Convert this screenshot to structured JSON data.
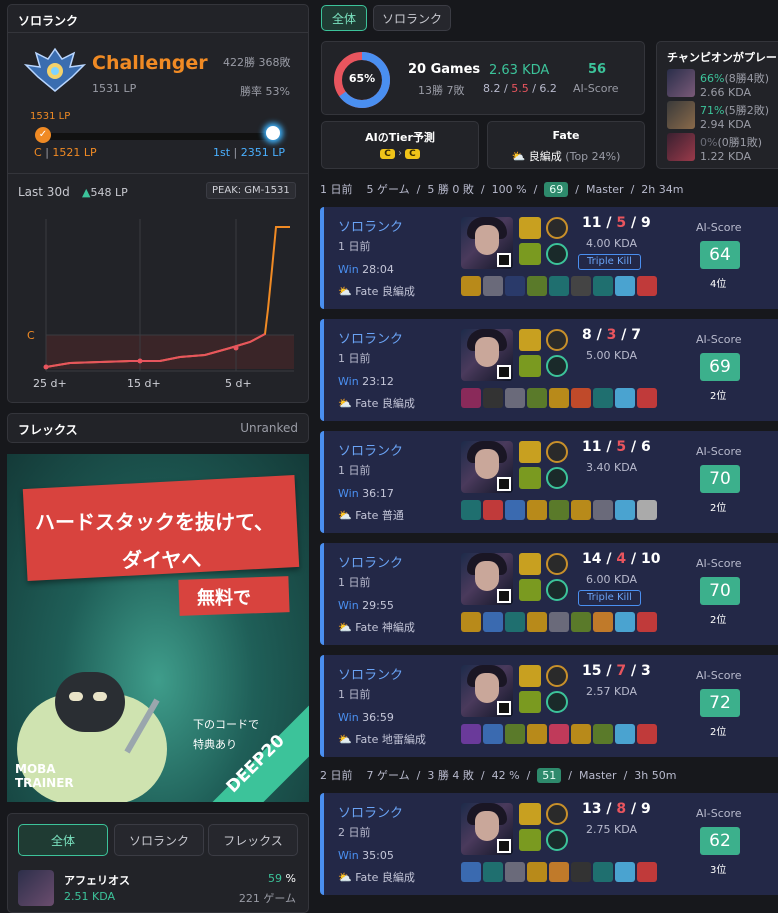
{
  "sidebar": {
    "solo": {
      "title": "ソロランク",
      "tier": "Challenger",
      "lp": "1531 LP",
      "record": "422勝 368敗",
      "winrate": "勝率 53%",
      "current_marker": "1531 LP",
      "current_tier": "C",
      "threshold_label": "1521 LP",
      "first_label": "1st",
      "first_lp": "2351 LP",
      "last30_label": "Last 30d",
      "last30_gain": "548 LP",
      "peak": "PEAK: GM-1531",
      "chart_tier_label": "C",
      "x_ticks": [
        "25 d+",
        "15 d+",
        "5 d+"
      ]
    },
    "flex": {
      "title": "フレックス",
      "status": "Unranked"
    },
    "ad": {
      "line1": "ハードスタックを抜けて、",
      "line2": "ダイヤへ",
      "line3": "無料で",
      "code_line1": "下のコードで",
      "code_line2": "特典あり",
      "brand1": "MOBA",
      "brand2": "TRAINER",
      "code": "DEEP20"
    },
    "tabs": [
      "全体",
      "ソロランク",
      "フレックス"
    ],
    "champ_row": {
      "name": "アフェリオス",
      "winrate": "59",
      "pct": "%",
      "kda": "2.51 KDA",
      "games": "221 ゲーム"
    }
  },
  "top_tabs": [
    "全体",
    "ソロランク"
  ],
  "summary": {
    "donut_pct": "65%",
    "win_fraction": 0.65,
    "games": "20 Games",
    "record": "13勝 7敗",
    "kda": "2.63 KDA",
    "kda_k": "8.2",
    "kda_d": "5.5",
    "kda_a": "6.2",
    "aiscore": "56",
    "aiscore_label": "AI-Score"
  },
  "tier_pred": {
    "title": "AIのTier予測",
    "from": "C",
    "to": "C"
  },
  "fate": {
    "title": "Fate",
    "value": "良編成",
    "sub": "(Top 24%)"
  },
  "champ_panel": {
    "title": "チャンピオンがプレー",
    "rows": [
      {
        "wr": "66%",
        "rec": "(8勝4敗)",
        "kda": "2.66 KDA"
      },
      {
        "wr": "71%",
        "rec": "(5勝2敗)",
        "kda": "2.94 KDA"
      },
      {
        "wr": "0%",
        "rec": "(0勝1敗)",
        "kda": "1.22 KDA"
      }
    ]
  },
  "day1": {
    "day": "1 日前",
    "games": "5 ゲーム",
    "sep1": "/",
    "rec": "5 勝 0 敗",
    "sep2": "/",
    "pct": "100 %",
    "sep3": "/",
    "score": "69",
    "sep4": "/",
    "tier": "Master",
    "sep5": "/",
    "time": "2h 34m"
  },
  "day2": {
    "day": "2 日前",
    "games": "7 ゲーム",
    "sep1": "/",
    "rec": "3 勝 4 敗",
    "sep2": "/",
    "pct": "42 %",
    "sep3": "/",
    "score": "51",
    "sep4": "/",
    "tier": "Master",
    "sep5": "/",
    "time": "3h 50m"
  },
  "matches": [
    {
      "queue": "ソロランク",
      "ago": "1 日前",
      "result": "Win",
      "duration": "28:04",
      "fate_label": "Fate",
      "fate": "良編成",
      "k": "11",
      "d": "5",
      "a": "9",
      "kda": "4.00 KDA",
      "multi": "Triple Kill",
      "ai_label": "AI-Score",
      "score": "64",
      "rank": "4位"
    },
    {
      "queue": "ソロランク",
      "ago": "1 日前",
      "result": "Win",
      "duration": "23:12",
      "fate_label": "Fate",
      "fate": "良編成",
      "k": "8",
      "d": "3",
      "a": "7",
      "kda": "5.00 KDA",
      "multi": "",
      "ai_label": "AI-Score",
      "score": "69",
      "rank": "2位"
    },
    {
      "queue": "ソロランク",
      "ago": "1 日前",
      "result": "Win",
      "duration": "36:17",
      "fate_label": "Fate",
      "fate": "普通",
      "k": "11",
      "d": "5",
      "a": "6",
      "kda": "3.40 KDA",
      "multi": "",
      "ai_label": "AI-Score",
      "score": "70",
      "rank": "2位"
    },
    {
      "queue": "ソロランク",
      "ago": "1 日前",
      "result": "Win",
      "duration": "29:55",
      "fate_label": "Fate",
      "fate": "神編成",
      "k": "14",
      "d": "4",
      "a": "10",
      "kda": "6.00 KDA",
      "multi": "Triple Kill",
      "ai_label": "AI-Score",
      "score": "70",
      "rank": "2位"
    },
    {
      "queue": "ソロランク",
      "ago": "1 日前",
      "result": "Win",
      "duration": "36:59",
      "fate_label": "Fate",
      "fate": "地雷編成",
      "k": "15",
      "d": "7",
      "a": "3",
      "kda": "2.57 KDA",
      "multi": "",
      "ai_label": "AI-Score",
      "score": "72",
      "rank": "2位"
    },
    {
      "queue": "ソロランク",
      "ago": "2 日前",
      "result": "Win",
      "duration": "35:05",
      "fate_label": "Fate",
      "fate": "良編成",
      "k": "13",
      "d": "8",
      "a": "9",
      "kda": "2.75 KDA",
      "multi": "",
      "ai_label": "AI-Score",
      "score": "62",
      "rank": "3位"
    }
  ]
}
